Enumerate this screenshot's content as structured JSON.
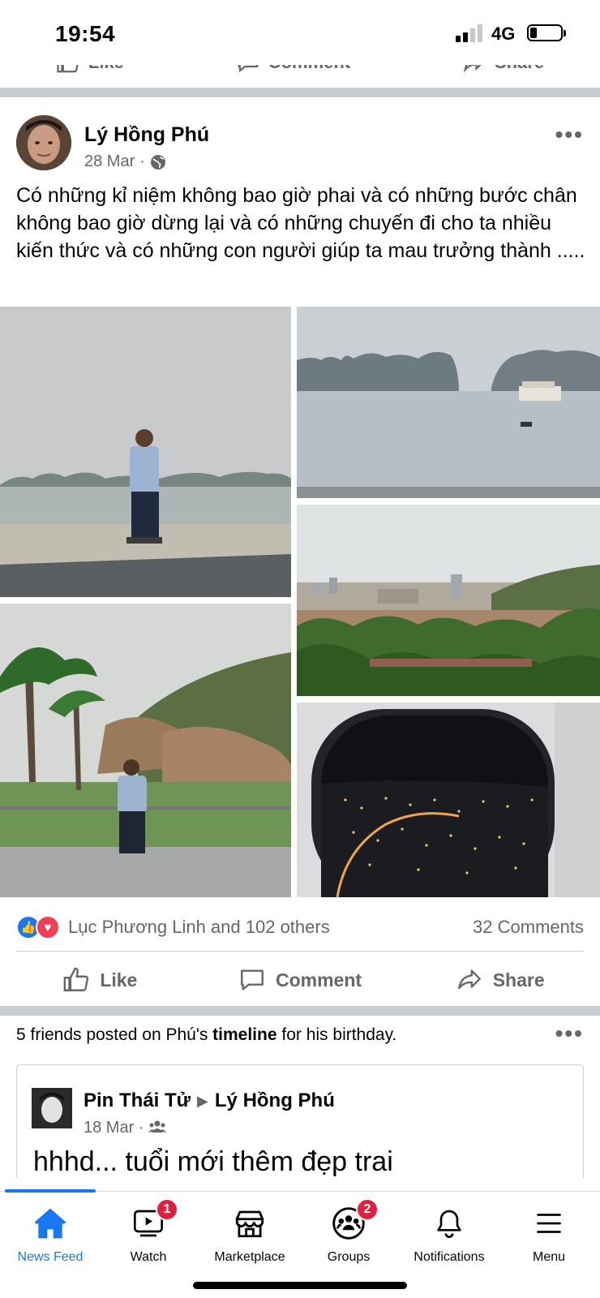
{
  "status_bar": {
    "time": "19:54",
    "network": "4G"
  },
  "top_actions": {
    "like": "Like",
    "comment": "Comment",
    "share": "Share"
  },
  "post": {
    "author": "Lý Hồng Phú",
    "date": "28 Mar",
    "meta_separator": "·",
    "privacy_icon": "globe-icon",
    "more": "•••",
    "text": "Có những kỉ niệm không bao giờ phai và có những bước chân không bao giờ dừng lại và có những chuyến đi cho ta nhiều kiến thức và có những con người giúp ta mau trưởng thành .....",
    "reactions": {
      "names": "Lục Phương Linh and 102 others",
      "comments": "32 Comments"
    },
    "actions": {
      "like": "Like",
      "comment": "Comment",
      "share": "Share"
    }
  },
  "birthday": {
    "title_start": "5 friends posted on Phú's ",
    "title_bold": "timeline",
    "title_end": " for his birthday.",
    "more": "•••",
    "inner": {
      "author_from": "Pin Thái Tử",
      "arrow": "▶",
      "author_to": "Lý Hồng Phú",
      "date": "18 Mar",
      "meta_separator": "·",
      "audience_icon": "friends-icon",
      "text": "hhhd... tuổi mới thêm đẹp trai"
    }
  },
  "tabbar": {
    "items": [
      {
        "label": "News Feed",
        "icon": "home-icon",
        "active": true
      },
      {
        "label": "Watch",
        "icon": "watch-icon",
        "badge": "1"
      },
      {
        "label": "Marketplace",
        "icon": "marketplace-icon"
      },
      {
        "label": "Groups",
        "icon": "groups-icon",
        "badge": "2"
      },
      {
        "label": "Notifications",
        "icon": "bell-icon"
      },
      {
        "label": "Menu",
        "icon": "menu-icon"
      }
    ]
  },
  "colors": {
    "accent": "#1877f2",
    "secondary_text": "#65676b",
    "badge": "#e41e3f",
    "separator": "#c9ccd1"
  }
}
